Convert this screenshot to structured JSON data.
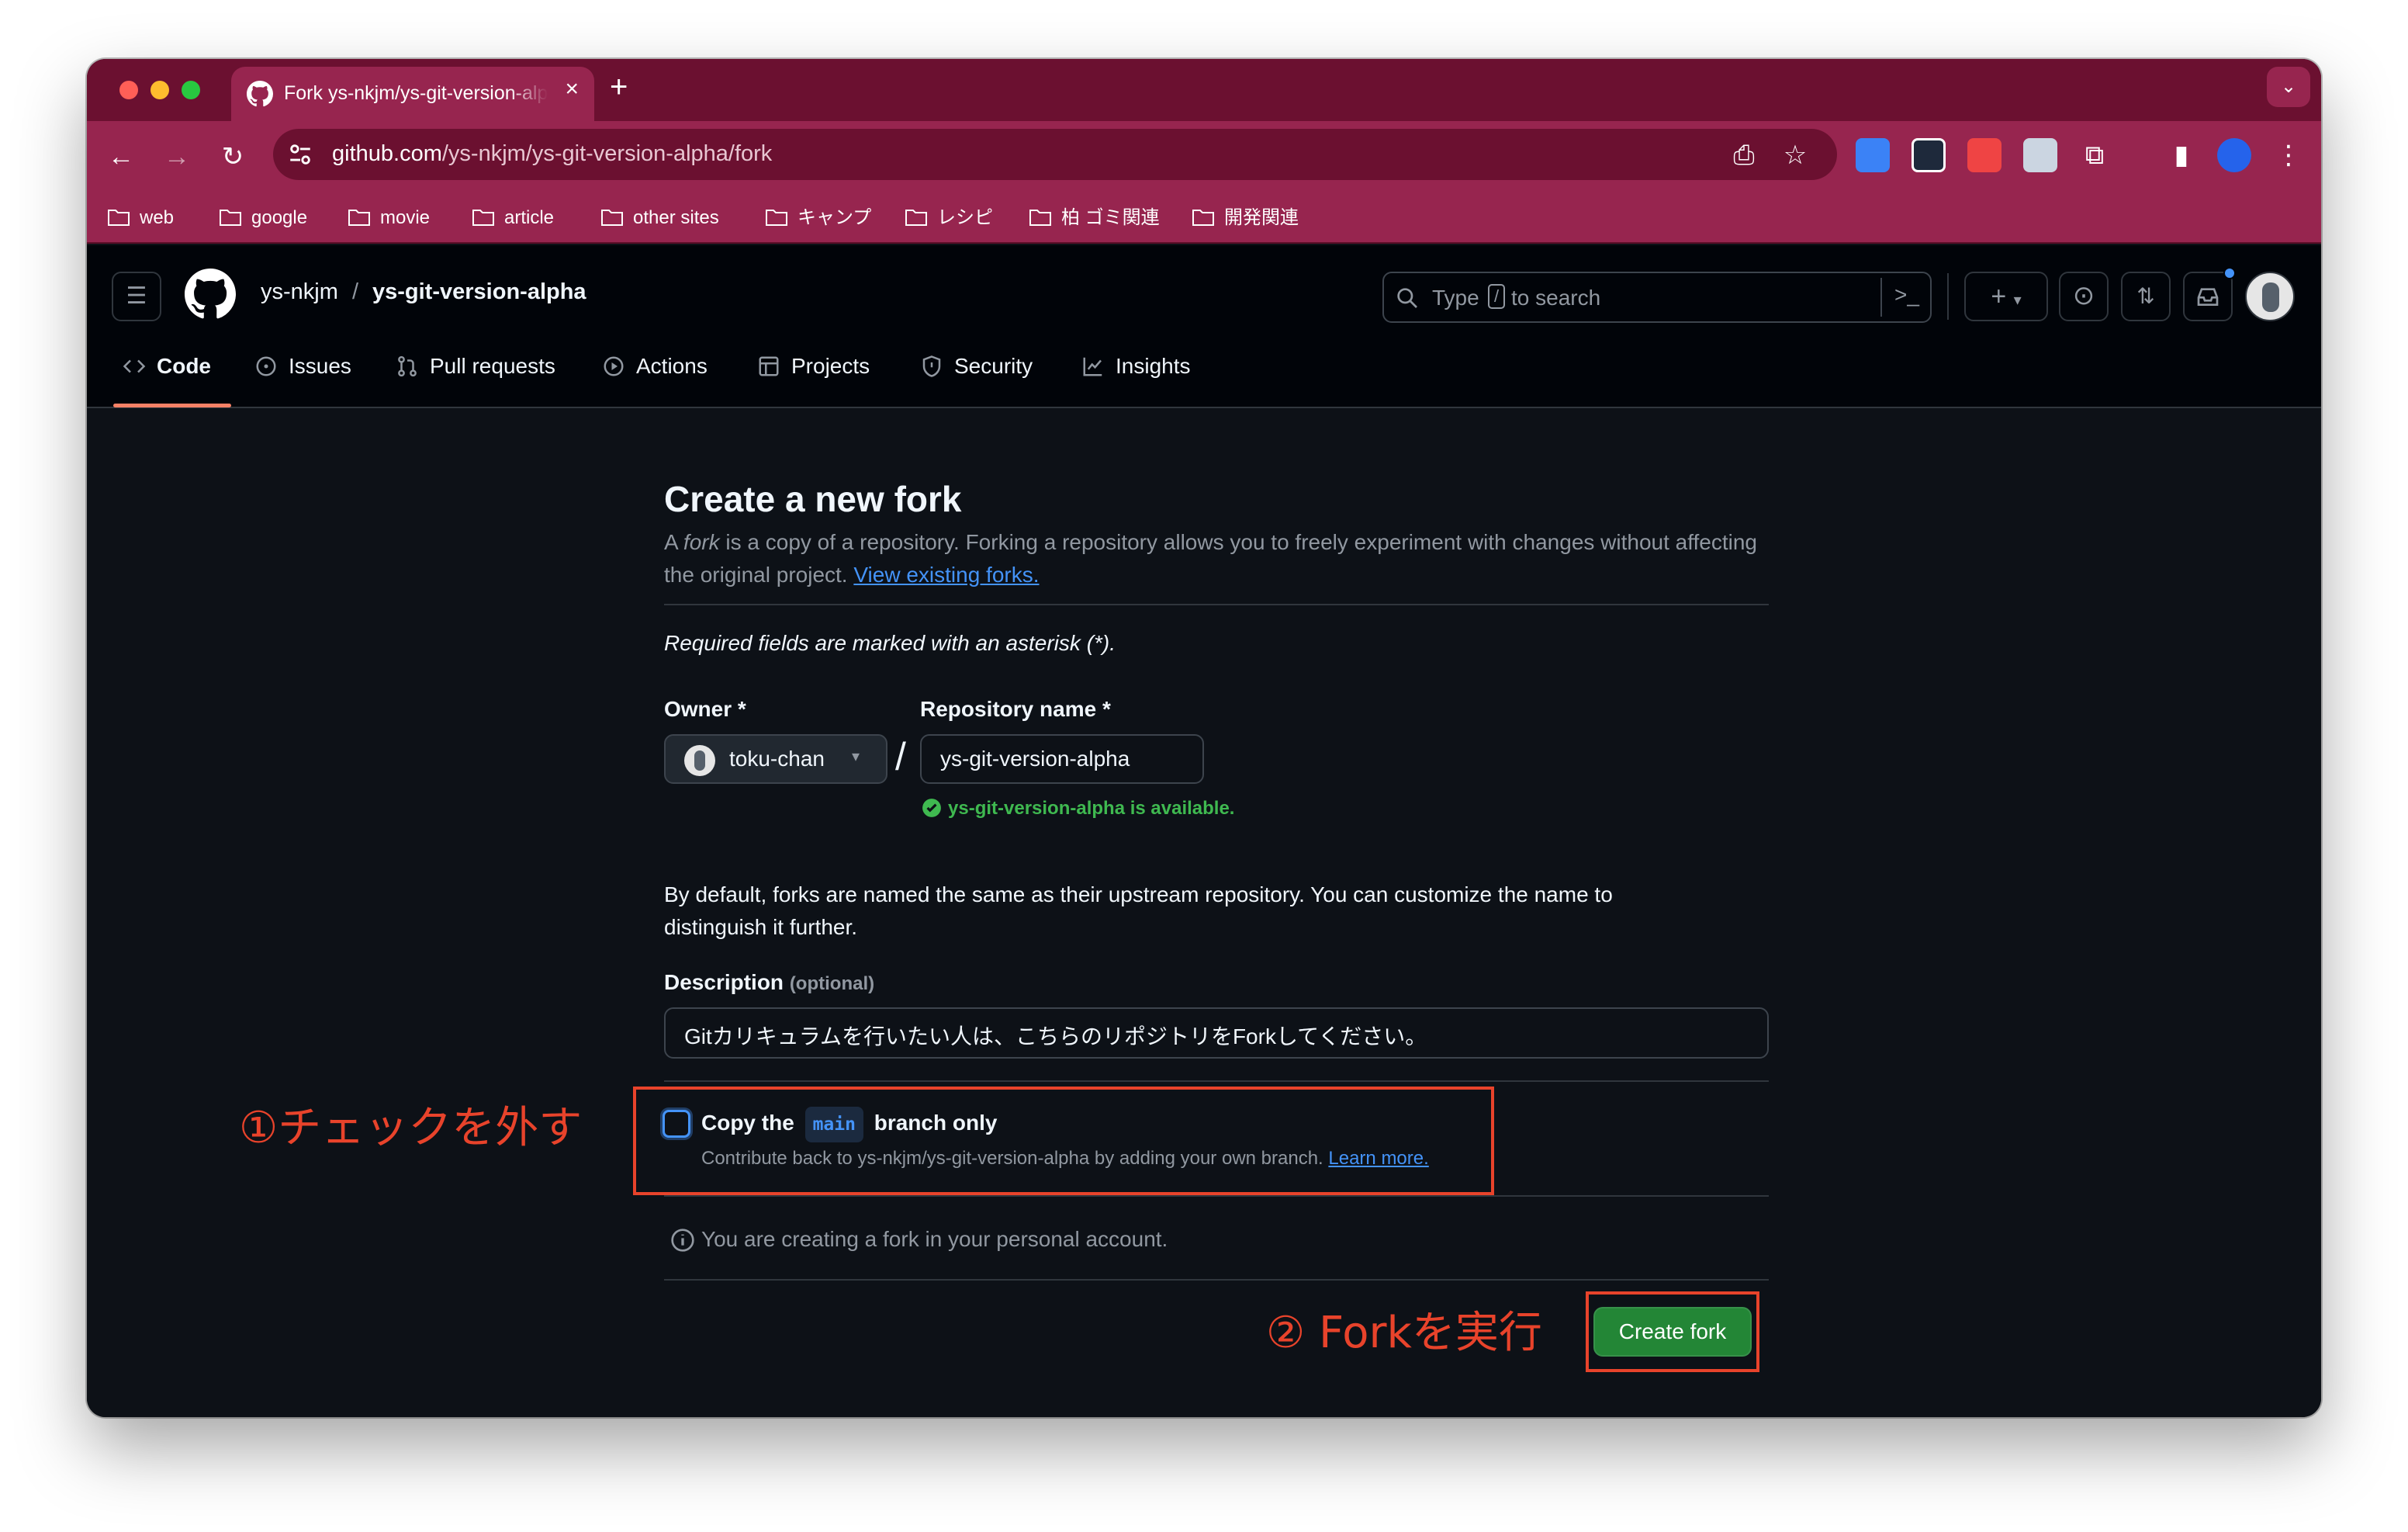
{
  "browser": {
    "tab_title": "Fork ys-nkjm/ys-git-version-alpha",
    "tab_close": "×",
    "new_tab": "+",
    "url_host": "github.com",
    "url_path": "/ys-nkjm/ys-git-version-alpha/fork",
    "bookmarks": [
      "web",
      "google",
      "movie",
      "article",
      "other sites",
      "キャンプ",
      "レシピ",
      "柏 ゴミ関連",
      "開発関連"
    ],
    "colors": {
      "frame": "#6b1030",
      "toolbar": "#97254f"
    }
  },
  "github": {
    "owner_crumb": "ys-nkjm",
    "separator": "/",
    "repo_crumb": "ys-git-version-alpha",
    "search_prefix": "Type",
    "search_key": "/",
    "search_suffix": "to search",
    "create_new": "+",
    "nav": [
      "Code",
      "Issues",
      "Pull requests",
      "Actions",
      "Projects",
      "Security",
      "Insights"
    ],
    "active_tab": "Code"
  },
  "form": {
    "heading": "Create a new fork",
    "intro_a": "A",
    "intro_fork": "fork",
    "intro_b": "is a copy of a repository. Forking a repository allows you to freely experiment with changes without affecting the original project.",
    "view_forks_link": "View existing forks.",
    "required_note": "Required fields are marked with an asterisk (*).",
    "owner_label": "Owner *",
    "owner_value": "toku-chan",
    "slash": "/",
    "repo_label": "Repository name *",
    "repo_value": "ys-git-version-alpha",
    "availability": "ys-git-version-alpha is available.",
    "naming_note": "By default, forks are named the same as their upstream repository. You can customize the name to distinguish it further.",
    "description_label": "Description",
    "description_optional": "(optional)",
    "description_value": "Gitカリキュラムを行いたい人は、こちらのリポジトリをForkしてください。",
    "copy_a": "Copy the",
    "copy_code": "main",
    "copy_b": "branch only",
    "copy_checked": false,
    "copy_hint": "Contribute back to ys-nkjm/ys-git-version-alpha by adding your own branch.",
    "learn_more": "Learn more.",
    "personal_note": "You are creating a fork in your personal account.",
    "create_button": "Create fork"
  },
  "annotations": {
    "step1": "①チェックを外す",
    "step2": "② Forkを実行",
    "color": "#e8432b"
  }
}
